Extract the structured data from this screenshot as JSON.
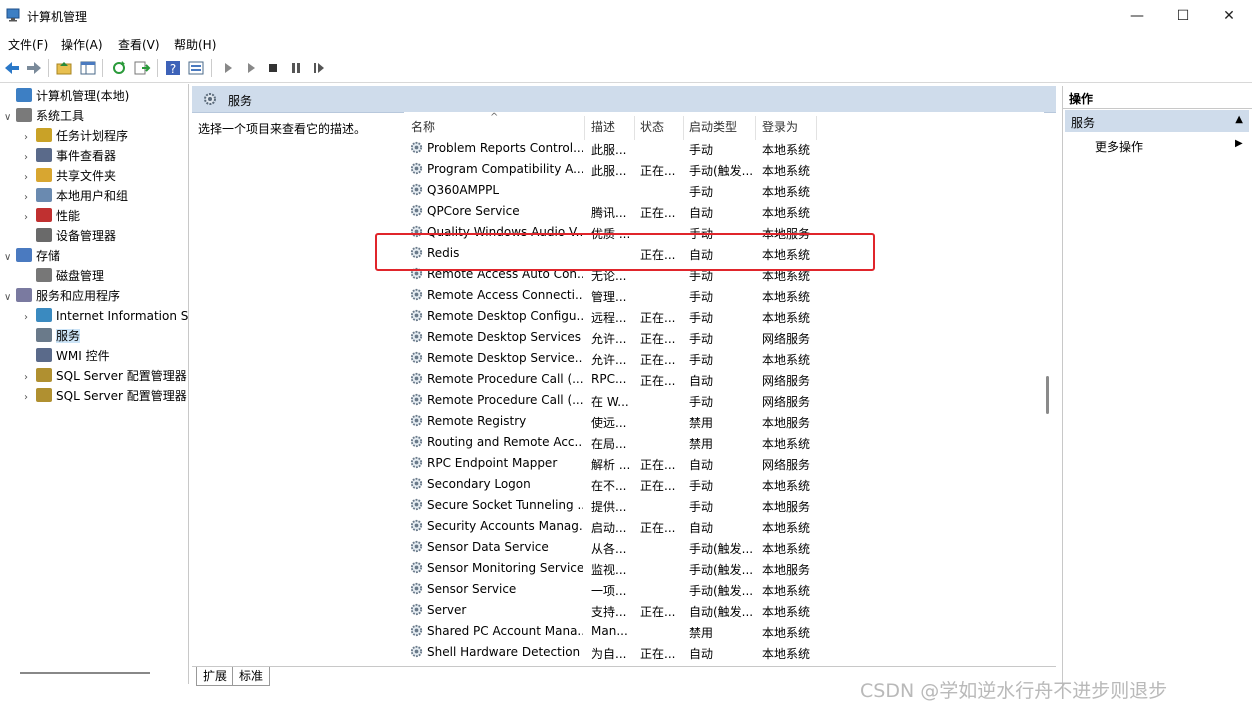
{
  "window": {
    "title": "计算机管理",
    "controls": {
      "minimize": "—",
      "maximize": "☐",
      "close": "✕"
    }
  },
  "menu": [
    "文件(F)",
    "操作(A)",
    "查看(V)",
    "帮助(H)"
  ],
  "toolbar": [
    "back-icon",
    "forward-icon",
    "up-folder-icon",
    "show-hide-tree-icon",
    "refresh-icon",
    "export-icon",
    "help-icon",
    "properties-icon",
    "play-icon",
    "play-alt-icon",
    "stop-icon",
    "pause-icon",
    "restart-icon"
  ],
  "tree": [
    {
      "label": "计算机管理(本地)",
      "level": 0,
      "exp": "",
      "icon": "computer"
    },
    {
      "label": "系统工具",
      "level": 0,
      "exp": "∨",
      "icon": "tools"
    },
    {
      "label": "任务计划程序",
      "level": 1,
      "exp": "›",
      "icon": "clock"
    },
    {
      "label": "事件查看器",
      "level": 1,
      "exp": "›",
      "icon": "event"
    },
    {
      "label": "共享文件夹",
      "level": 1,
      "exp": "›",
      "icon": "folder"
    },
    {
      "label": "本地用户和组",
      "level": 1,
      "exp": "›",
      "icon": "users"
    },
    {
      "label": "性能",
      "level": 1,
      "exp": "›",
      "icon": "perf"
    },
    {
      "label": "设备管理器",
      "level": 1,
      "exp": "",
      "icon": "device"
    },
    {
      "label": "存储",
      "level": 0,
      "exp": "∨",
      "icon": "storage"
    },
    {
      "label": "磁盘管理",
      "level": 1,
      "exp": "",
      "icon": "disk"
    },
    {
      "label": "服务和应用程序",
      "level": 0,
      "exp": "∨",
      "icon": "apps"
    },
    {
      "label": "Internet Information Services",
      "level": 1,
      "exp": "›",
      "icon": "iis"
    },
    {
      "label": "服务",
      "level": 1,
      "exp": "",
      "icon": "gear",
      "selected": true
    },
    {
      "label": "WMI 控件",
      "level": 1,
      "exp": "",
      "icon": "wmi"
    },
    {
      "label": "SQL Server 配置管理器",
      "level": 1,
      "exp": "›",
      "icon": "sql"
    },
    {
      "label": "SQL Server 配置管理器",
      "level": 1,
      "exp": "›",
      "icon": "sql"
    }
  ],
  "services_pane": {
    "title": "服务",
    "description": "选择一个项目来查看它的描述。",
    "columns": [
      "名称",
      "描述",
      "状态",
      "启动类型",
      "登录为"
    ],
    "rows": [
      [
        "Problem Reports Control...",
        "此服...",
        "",
        "手动",
        "本地系统"
      ],
      [
        "Program Compatibility A...",
        "此服...",
        "正在...",
        "手动(触发...",
        "本地系统"
      ],
      [
        "Q360AMPPL",
        "",
        "",
        "手动",
        "本地系统"
      ],
      [
        "QPCore Service",
        "腾讯...",
        "正在...",
        "自动",
        "本地系统"
      ],
      [
        "Quality Windows Audio V...",
        "优质 ...",
        "",
        "手动",
        "本地服务"
      ],
      [
        "Redis",
        "",
        "正在...",
        "自动",
        "本地系统"
      ],
      [
        "Remote Access Auto Con...",
        "无论...",
        "",
        "手动",
        "本地系统"
      ],
      [
        "Remote Access Connecti...",
        "管理...",
        "",
        "手动",
        "本地系统"
      ],
      [
        "Remote Desktop Configu...",
        "远程...",
        "正在...",
        "手动",
        "本地系统"
      ],
      [
        "Remote Desktop Services",
        "允许...",
        "正在...",
        "手动",
        "网络服务"
      ],
      [
        "Remote Desktop Service...",
        "允许...",
        "正在...",
        "手动",
        "本地系统"
      ],
      [
        "Remote Procedure Call (...",
        "RPC...",
        "正在...",
        "自动",
        "网络服务"
      ],
      [
        "Remote Procedure Call (...",
        "在 W...",
        "",
        "手动",
        "网络服务"
      ],
      [
        "Remote Registry",
        "使远...",
        "",
        "禁用",
        "本地服务"
      ],
      [
        "Routing and Remote Acc...",
        "在局...",
        "",
        "禁用",
        "本地系统"
      ],
      [
        "RPC Endpoint Mapper",
        "解析 ...",
        "正在...",
        "自动",
        "网络服务"
      ],
      [
        "Secondary Logon",
        "在不...",
        "正在...",
        "手动",
        "本地系统"
      ],
      [
        "Secure Socket Tunneling ...",
        "提供...",
        "",
        "手动",
        "本地服务"
      ],
      [
        "Security Accounts Manag...",
        "启动...",
        "正在...",
        "自动",
        "本地系统"
      ],
      [
        "Sensor Data Service",
        "从各...",
        "",
        "手动(触发...",
        "本地系统"
      ],
      [
        "Sensor Monitoring Service",
        "监视...",
        "",
        "手动(触发...",
        "本地服务"
      ],
      [
        "Sensor Service",
        "一项...",
        "",
        "手动(触发...",
        "本地系统"
      ],
      [
        "Server",
        "支持...",
        "正在...",
        "自动(触发...",
        "本地系统"
      ],
      [
        "Shared PC Account Mana...",
        "Man...",
        "",
        "禁用",
        "本地系统"
      ],
      [
        "Shell Hardware Detection",
        "为自...",
        "正在...",
        "自动",
        "本地系统"
      ]
    ],
    "highlighted": "Redis",
    "tabs": [
      "扩展",
      "标准"
    ]
  },
  "actions": {
    "title": "操作",
    "section": "服务",
    "more": "更多操作"
  },
  "watermark": "CSDN @学如逆水行舟不进步则退步",
  "colors": {
    "pane_header": "#cfdceb",
    "highlight_box": "#e0252b",
    "selection": "#cce4f7"
  }
}
